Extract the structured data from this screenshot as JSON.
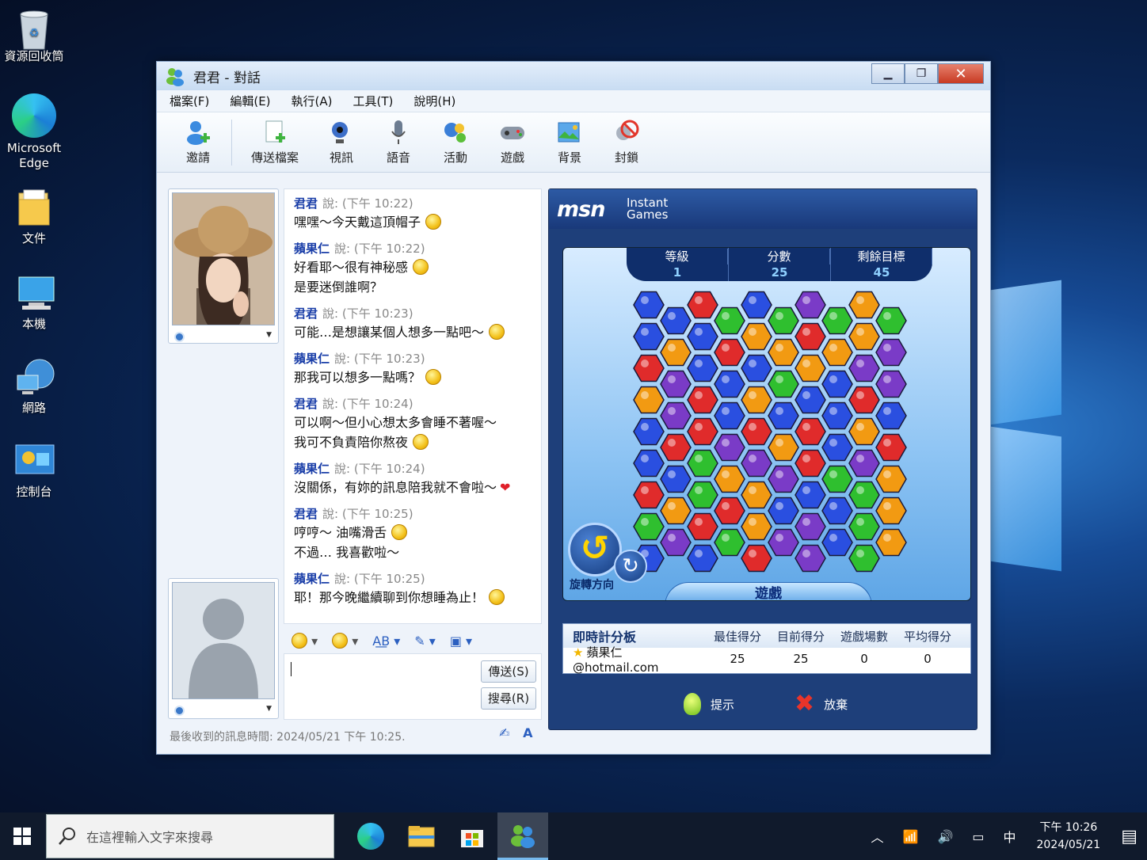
{
  "desktop": {
    "icons": [
      "資源回收筒",
      "Microsoft Edge",
      "文件",
      "本機",
      "網路",
      "控制台"
    ]
  },
  "window": {
    "title": "君君 - 對話",
    "menu": [
      "檔案(F)",
      "編輯(E)",
      "執行(A)",
      "工具(T)",
      "說明(H)"
    ],
    "toolbar": [
      "邀請",
      "傳送檔案",
      "視訊",
      "語音",
      "活動",
      "遊戲",
      "背景",
      "封鎖"
    ]
  },
  "chat": {
    "messages": [
      {
        "sender": "君君",
        "said": "說:",
        "time": "(下午 10:22)",
        "lines": [
          "嘿嘿～今天戴這頂帽子"
        ]
      },
      {
        "sender": "蘋果仁",
        "said": "說:",
        "time": "(下午 10:22)",
        "lines": [
          "好看耶～很有神秘感",
          "是要迷倒誰啊？"
        ]
      },
      {
        "sender": "君君",
        "said": "說:",
        "time": "(下午 10:23)",
        "lines": [
          "可能…是想讓某個人想多一點吧～"
        ]
      },
      {
        "sender": "蘋果仁",
        "said": "說:",
        "time": "(下午 10:23)",
        "lines": [
          "那我可以想多一點嗎？"
        ]
      },
      {
        "sender": "君君",
        "said": "說:",
        "time": "(下午 10:24)",
        "lines": [
          "可以啊～但小心想太多會睡不著喔～",
          "我可不負責陪你熬夜"
        ]
      },
      {
        "sender": "蘋果仁",
        "said": "說:",
        "time": "(下午 10:24)",
        "lines": [
          "沒關係，有妳的訊息陪我就不會啦～"
        ]
      },
      {
        "sender": "君君",
        "said": "說:",
        "time": "(下午 10:25)",
        "lines": [
          "哼哼～ 油嘴滑舌",
          "不過… 我喜歡啦～"
        ]
      },
      {
        "sender": "蘋果仁",
        "said": "說:",
        "time": "(下午 10:25)",
        "lines": [
          "耶！那今晚繼續聊到你想睡為止！"
        ]
      }
    ],
    "send_button": "傳送(S)",
    "search_button": "搜尋(R)",
    "input_value": "",
    "status": "最後收到的訊息時間: 2024/05/21 下午 10:25."
  },
  "game": {
    "brand": "msn",
    "brand_sub": [
      "Instant",
      "Games"
    ],
    "stats": [
      {
        "label": "等級",
        "value": "1"
      },
      {
        "label": "分數",
        "value": "25"
      },
      {
        "label": "剩餘目標",
        "value": "45"
      }
    ],
    "rotate_label": "旋轉方向",
    "play_label": "遊戲",
    "scoreboard": {
      "title": "即時計分板",
      "columns": [
        "最佳得分",
        "目前得分",
        "遊戲場數",
        "平均得分"
      ],
      "rows": [
        {
          "player": "蘋果仁@hotmail.com",
          "best": "25",
          "current": "25",
          "games": "0",
          "avg": "0"
        }
      ]
    },
    "hint": "提示",
    "giveup": "放棄",
    "colors": [
      "#e02b2b",
      "#f29a12",
      "#2a4fe0",
      "#7a3bc7",
      "#2fbf2f"
    ]
  },
  "taskbar": {
    "search_placeholder": "在這裡輸入文字來搜尋",
    "ime": "中",
    "time": "下午 10:26",
    "date": "2024/05/21"
  }
}
